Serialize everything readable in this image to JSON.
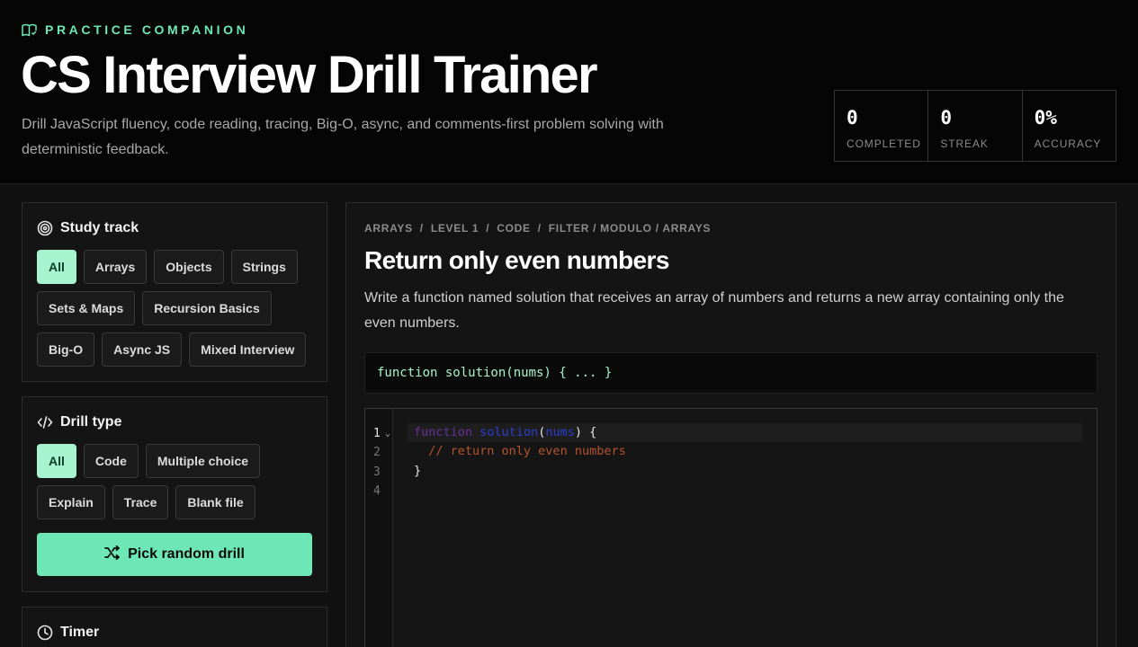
{
  "header": {
    "eyebrow": "PRACTICE COMPANION",
    "title": "CS Interview Drill Trainer",
    "subtitle": "Drill JavaScript fluency, code reading, tracing, Big-O, async, and comments-first problem solving with deterministic feedback."
  },
  "stats": [
    {
      "value": "0",
      "label": "COMPLETED"
    },
    {
      "value": "0",
      "label": "STREAK"
    },
    {
      "value": "0%",
      "label": "ACCURACY"
    }
  ],
  "study_track": {
    "title": "Study track",
    "chips": [
      "All",
      "Arrays",
      "Objects",
      "Strings",
      "Sets & Maps",
      "Recursion Basics",
      "Big-O",
      "Async JS",
      "Mixed Interview"
    ],
    "active": "All"
  },
  "drill_type": {
    "title": "Drill type",
    "chips": [
      "All",
      "Code",
      "Multiple choice",
      "Explain",
      "Trace",
      "Blank file"
    ],
    "active": "All",
    "random_label": "Pick random drill"
  },
  "timer": {
    "title": "Timer"
  },
  "drill": {
    "crumbs": [
      "ARRAYS",
      "LEVEL 1",
      "CODE",
      "FILTER / MODULO / ARRAYS"
    ],
    "title": "Return only even numbers",
    "description": "Write a function named solution that receives an array of numbers and returns a new array containing only the even numbers.",
    "signature": "function solution(nums) { ... }"
  },
  "editor": {
    "line_numbers": [
      "1",
      "2",
      "3",
      "4"
    ],
    "code": {
      "kw": "function",
      "fn": "solution",
      "param": "nums",
      "open": " {",
      "comment": "// return only even numbers",
      "close": "}"
    }
  },
  "colors": {
    "accent": "#6ee7b7",
    "accent_light": "#a7f3d0",
    "background": "#111111",
    "header_bg": "#050505"
  }
}
